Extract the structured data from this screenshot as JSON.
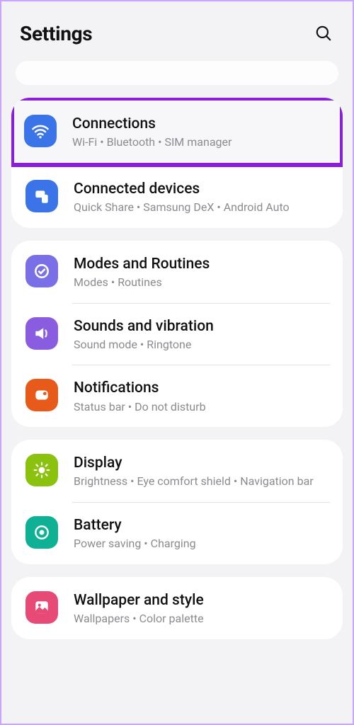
{
  "header": {
    "title": "Settings"
  },
  "groups": [
    {
      "items": [
        {
          "key": "connections",
          "title": "Connections",
          "subtitle": "Wi-Fi  •  Bluetooth  •  SIM manager",
          "highlight": true
        },
        {
          "key": "connected-devices",
          "title": "Connected devices",
          "subtitle": "Quick Share  •  Samsung DeX  •  Android Auto"
        }
      ]
    },
    {
      "items": [
        {
          "key": "modes-routines",
          "title": "Modes and Routines",
          "subtitle": "Modes  •  Routines"
        },
        {
          "key": "sounds-vibration",
          "title": "Sounds and vibration",
          "subtitle": "Sound mode  •  Ringtone"
        },
        {
          "key": "notifications",
          "title": "Notifications",
          "subtitle": "Status bar  •  Do not disturb"
        }
      ]
    },
    {
      "items": [
        {
          "key": "display",
          "title": "Display",
          "subtitle": "Brightness  •  Eye comfort shield  •  Navigation bar"
        },
        {
          "key": "battery",
          "title": "Battery",
          "subtitle": "Power saving  •  Charging"
        }
      ]
    },
    {
      "items": [
        {
          "key": "wallpaper-style",
          "title": "Wallpaper and style",
          "subtitle": "Wallpapers  •  Color palette"
        }
      ]
    }
  ]
}
